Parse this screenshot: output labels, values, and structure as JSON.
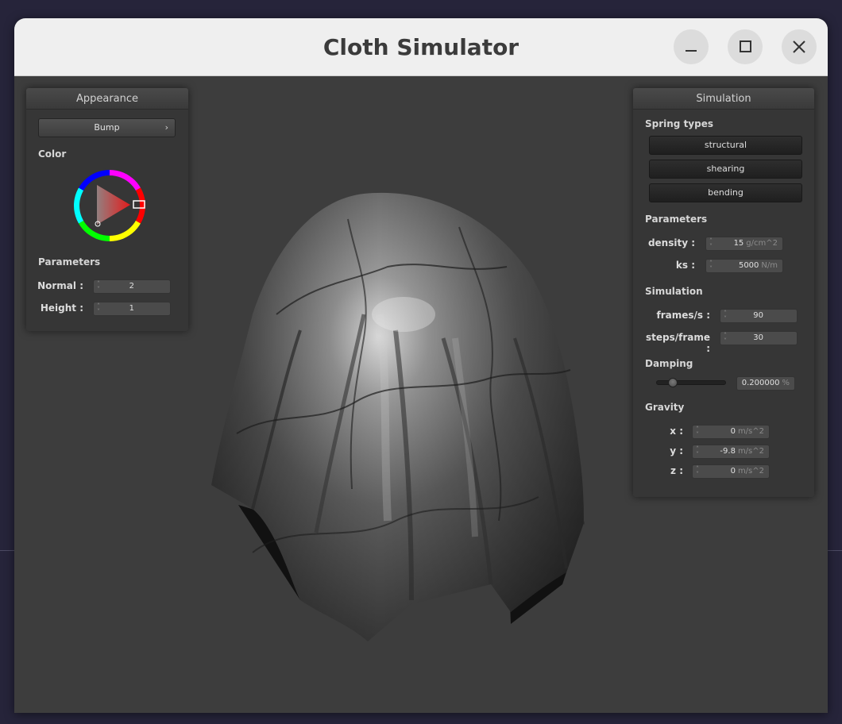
{
  "window": {
    "title": "Cloth Simulator",
    "minimize_icon": "minimize-icon",
    "maximize_icon": "maximize-icon",
    "close_icon": "close-icon"
  },
  "appearance": {
    "title": "Appearance",
    "shader_popup": "Bump",
    "popup_arrow": "›",
    "color_label": "Color",
    "color_picker_icon": "color-wheel-icon",
    "params_label": "Parameters",
    "normal_label": "Normal :",
    "normal_value": "2",
    "height_label": "Height :",
    "height_value": "1",
    "accent": "#e31c1c"
  },
  "simulation": {
    "title": "Simulation",
    "spring_types_label": "Spring types",
    "spring_buttons": [
      "structural",
      "shearing",
      "bending"
    ],
    "params_label": "Parameters",
    "density_label": "density :",
    "density_value": "15",
    "density_unit": "g/cm^2",
    "ks_label": "ks :",
    "ks_value": "5000",
    "ks_unit": "N/m",
    "sim_label": "Simulation",
    "fps_label": "frames/s :",
    "fps_value": "90",
    "steps_label": "steps/frame :",
    "steps_value": "30",
    "damping_label": "Damping",
    "damping_value": "0.200000",
    "damping_unit": "%",
    "damping_slider_fraction": 0.2,
    "gravity_label": "Gravity",
    "gx_label": "x :",
    "gx_value": "0",
    "gy_label": "y :",
    "gy_value": "-9.8",
    "gz_label": "z :",
    "gz_value": "0",
    "gravity_unit": "m/s^2"
  }
}
